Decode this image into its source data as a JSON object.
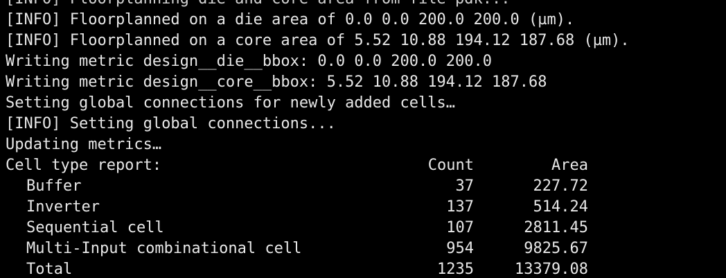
{
  "terminal": {
    "lines": [
      "[INFO] Floorplanning die and core area from file pdk...",
      "[INFO] Floorplanned on a die area of 0.0 0.0 200.0 200.0 (µm).",
      "[INFO] Floorplanned on a core area of 5.52 10.88 194.12 187.68 (µm).",
      "Writing metric design__die__bbox: 0.0 0.0 200.0 200.0",
      "Writing metric design__core__bbox: 5.52 10.88 194.12 187.68",
      "Setting global connections for newly added cells…",
      "[INFO] Setting global connections...",
      "Updating metrics…"
    ],
    "report": {
      "title": "Cell type report:",
      "col_count": "Count",
      "col_area": "Area",
      "rows": [
        {
          "name": "Buffer",
          "count": "37",
          "area": "227.72"
        },
        {
          "name": "Inverter",
          "count": "137",
          "area": "514.24"
        },
        {
          "name": "Sequential cell",
          "count": "107",
          "area": "2811.45"
        },
        {
          "name": "Multi-Input combinational cell",
          "count": "954",
          "area": "9825.67"
        },
        {
          "name": "Total",
          "count": "1235",
          "area": "13379.08"
        }
      ]
    }
  }
}
